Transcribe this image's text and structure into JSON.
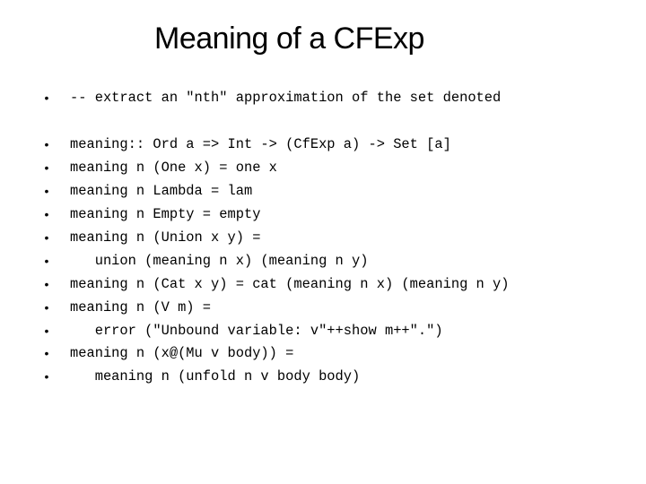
{
  "slide": {
    "title": "Meaning of a CFExp",
    "bullet_glyph": "•",
    "comment_line": "-- extract an \"nth\" approximation of the set denoted",
    "code_lines": [
      "meaning:: Ord a => Int -> (CfExp a) -> Set [a]",
      "meaning n (One x) = one x",
      "meaning n Lambda = lam",
      "meaning n Empty = empty",
      "meaning n (Union x y) =",
      "   union (meaning n x) (meaning n y)",
      "meaning n (Cat x y) = cat (meaning n x) (meaning n y)",
      "meaning n (V m) =",
      "   error (\"Unbound variable: v\"++show m++\".\")",
      "meaning n (x@(Mu v body)) =",
      "   meaning n (unfold n v body body)"
    ]
  }
}
